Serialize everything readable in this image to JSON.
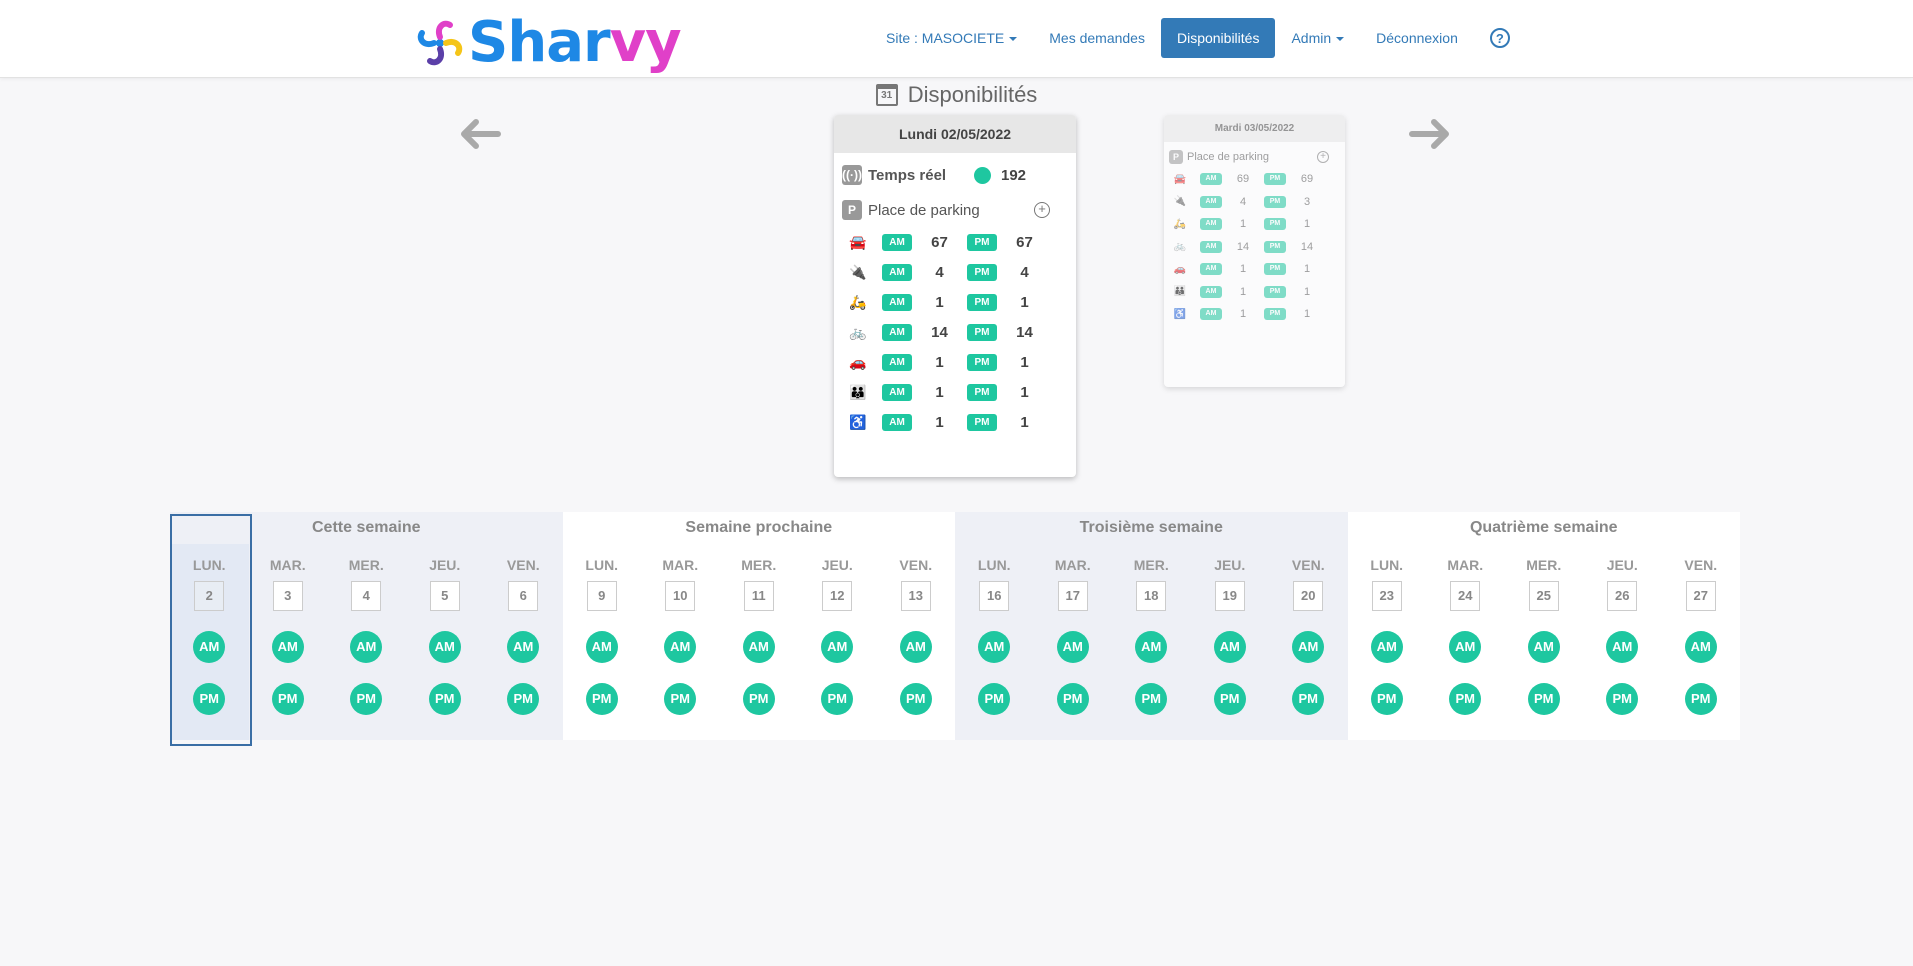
{
  "brand": {
    "part1": "Shar",
    "part2": "vy"
  },
  "nav": {
    "site": "Site : MASOCIETE",
    "requests": "Mes demandes",
    "availability": "Disponibilités",
    "admin": "Admin",
    "logout": "Déconnexion",
    "help": "?"
  },
  "page_title": "Disponibilités",
  "calendar_icon_text": "31",
  "cards": {
    "main": {
      "date": "Lundi 02/05/2022",
      "realtime_label": "Temps réel",
      "realtime_value": "192",
      "parking_label": "Place de parking",
      "rows": [
        {
          "icon": "car-icon",
          "am": "67",
          "pm": "67"
        },
        {
          "icon": "ev-plug-icon",
          "am": "4",
          "pm": "4"
        },
        {
          "icon": "scooter-icon",
          "am": "1",
          "pm": "1"
        },
        {
          "icon": "bicycle-icon",
          "am": "14",
          "pm": "14"
        },
        {
          "icon": "small-car-icon",
          "am": "1",
          "pm": "1"
        },
        {
          "icon": "family-icon",
          "am": "1",
          "pm": "1"
        },
        {
          "icon": "wheelchair-icon",
          "am": "1",
          "pm": "1"
        }
      ]
    },
    "next": {
      "date": "Mardi 03/05/2022",
      "parking_label": "Place de parking",
      "rows": [
        {
          "am": "69",
          "pm": "69"
        },
        {
          "am": "4",
          "pm": "3"
        },
        {
          "am": "1",
          "pm": "1"
        },
        {
          "am": "14",
          "pm": "14"
        },
        {
          "am": "1",
          "pm": "1"
        },
        {
          "am": "1",
          "pm": "1"
        },
        {
          "am": "1",
          "pm": "1"
        }
      ]
    }
  },
  "slot_labels": {
    "am": "AM",
    "pm": "PM"
  },
  "weeks": [
    {
      "title": "Cette semaine",
      "days": [
        {
          "name": "LUN.",
          "num": "2"
        },
        {
          "name": "MAR.",
          "num": "3"
        },
        {
          "name": "MER.",
          "num": "4"
        },
        {
          "name": "JEU.",
          "num": "5"
        },
        {
          "name": "VEN.",
          "num": "6"
        }
      ]
    },
    {
      "title": "Semaine prochaine",
      "days": [
        {
          "name": "LUN.",
          "num": "9"
        },
        {
          "name": "MAR.",
          "num": "10"
        },
        {
          "name": "MER.",
          "num": "11"
        },
        {
          "name": "JEU.",
          "num": "12"
        },
        {
          "name": "VEN.",
          "num": "13"
        }
      ]
    },
    {
      "title": "Troisième semaine",
      "days": [
        {
          "name": "LUN.",
          "num": "16"
        },
        {
          "name": "MAR.",
          "num": "17"
        },
        {
          "name": "MER.",
          "num": "18"
        },
        {
          "name": "JEU.",
          "num": "19"
        },
        {
          "name": "VEN.",
          "num": "20"
        }
      ]
    },
    {
      "title": "Quatrième semaine",
      "days": [
        {
          "name": "LUN.",
          "num": "23"
        },
        {
          "name": "MAR.",
          "num": "24"
        },
        {
          "name": "MER.",
          "num": "25"
        },
        {
          "name": "JEU.",
          "num": "26"
        },
        {
          "name": "VEN.",
          "num": "27"
        }
      ]
    }
  ],
  "colors": {
    "accent": "#337ab7",
    "available": "#1ec7a0",
    "brand_blue": "#1e88e5",
    "brand_pink": "#e040c8"
  }
}
